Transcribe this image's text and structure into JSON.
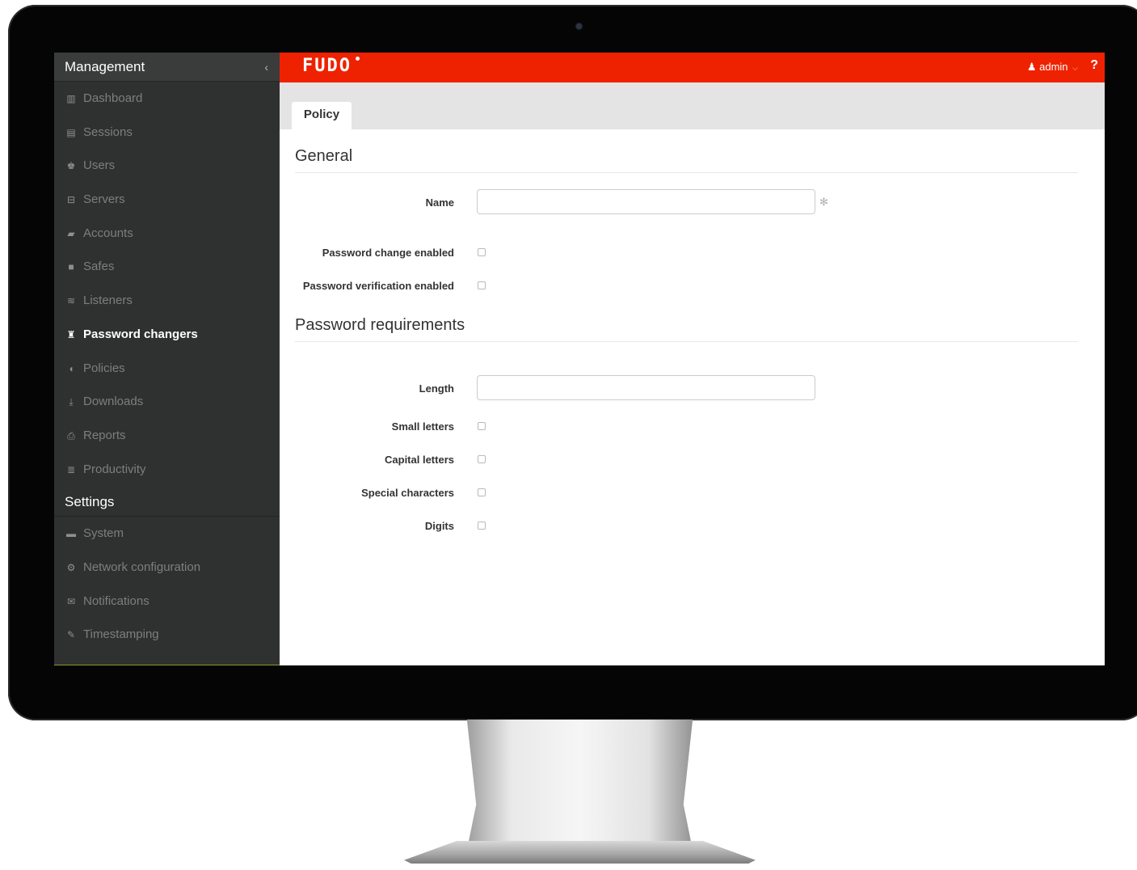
{
  "sidebar": {
    "management_title": "Management",
    "collapse_icon": "‹",
    "items": [
      {
        "label": "Dashboard",
        "icon": "▥"
      },
      {
        "label": "Sessions",
        "icon": "▤"
      },
      {
        "label": "Users",
        "icon": "♚"
      },
      {
        "label": "Servers",
        "icon": "⊟"
      },
      {
        "label": "Accounts",
        "icon": "▰"
      },
      {
        "label": "Safes",
        "icon": "■"
      },
      {
        "label": "Listeners",
        "icon": "≋"
      },
      {
        "label": "Password changers",
        "icon": "♜"
      },
      {
        "label": "Policies",
        "icon": "◖"
      },
      {
        "label": "Downloads",
        "icon": "⤓"
      },
      {
        "label": "Reports",
        "icon": "⎙"
      },
      {
        "label": "Productivity",
        "icon": "≣"
      }
    ],
    "settings_title": "Settings",
    "settings_items": [
      {
        "label": "System",
        "icon": "▬"
      },
      {
        "label": "Network configuration",
        "icon": "⚙"
      },
      {
        "label": "Notifications",
        "icon": "✉"
      },
      {
        "label": "Timestamping",
        "icon": "✎"
      }
    ]
  },
  "topbar": {
    "logo": "FUDO",
    "user": "admin",
    "user_icon": "♟",
    "caret": "⌵",
    "help": "?"
  },
  "tabs": [
    {
      "label": "Policy"
    }
  ],
  "form": {
    "general_title": "General",
    "name_label": "Name",
    "name_value": "",
    "required_mark": "✻",
    "password_change_label": "Password change enabled",
    "password_verification_label": "Password verification enabled",
    "requirements_title": "Password requirements",
    "length_label": "Length",
    "length_value": "",
    "small_letters_label": "Small letters",
    "capital_letters_label": "Capital letters",
    "special_characters_label": "Special characters",
    "digits_label": "Digits"
  },
  "colors": {
    "brand": "#ee2200",
    "sidebar_bg": "#2f3030"
  }
}
